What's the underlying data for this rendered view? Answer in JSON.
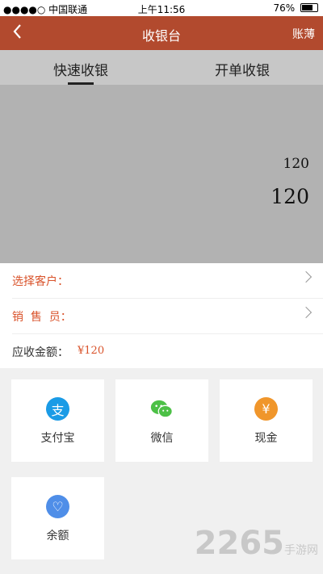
{
  "status_bar": {
    "carrier": "●●●●○ 中国联通",
    "time": "上午11:56",
    "battery": "76%",
    "battery_level": 0.76
  },
  "nav": {
    "back_icon": "chevron-left-icon",
    "title": "收银台",
    "right_button": "账薄"
  },
  "tabs": [
    {
      "label": "快速收银",
      "active": true
    },
    {
      "label": "开单收银",
      "active": false
    }
  ],
  "display": {
    "expression": "120",
    "result": "120"
  },
  "form": {
    "customer_label": "选择客户：",
    "salesperson_label": "销  售  员：",
    "amount_label": "应收金额：",
    "amount_value": "¥120"
  },
  "payment_methods": [
    {
      "label": "支付宝",
      "icon": "alipay-icon",
      "color": "#1a9be6",
      "glyph": "支"
    },
    {
      "label": "微信",
      "icon": "wechat-icon",
      "color": "#4cc046",
      "glyph": ""
    },
    {
      "label": "现金",
      "icon": "cash-icon",
      "color": "#f0962b",
      "glyph": "¥"
    },
    {
      "label": "余额",
      "icon": "balance-icon",
      "color": "#4f8ee8",
      "glyph": "♡"
    }
  ],
  "colors": {
    "nav_bg": "#b24a2e",
    "accent": "#d9532b"
  },
  "watermark": {
    "brand": "2265",
    "sub": "手游网"
  }
}
